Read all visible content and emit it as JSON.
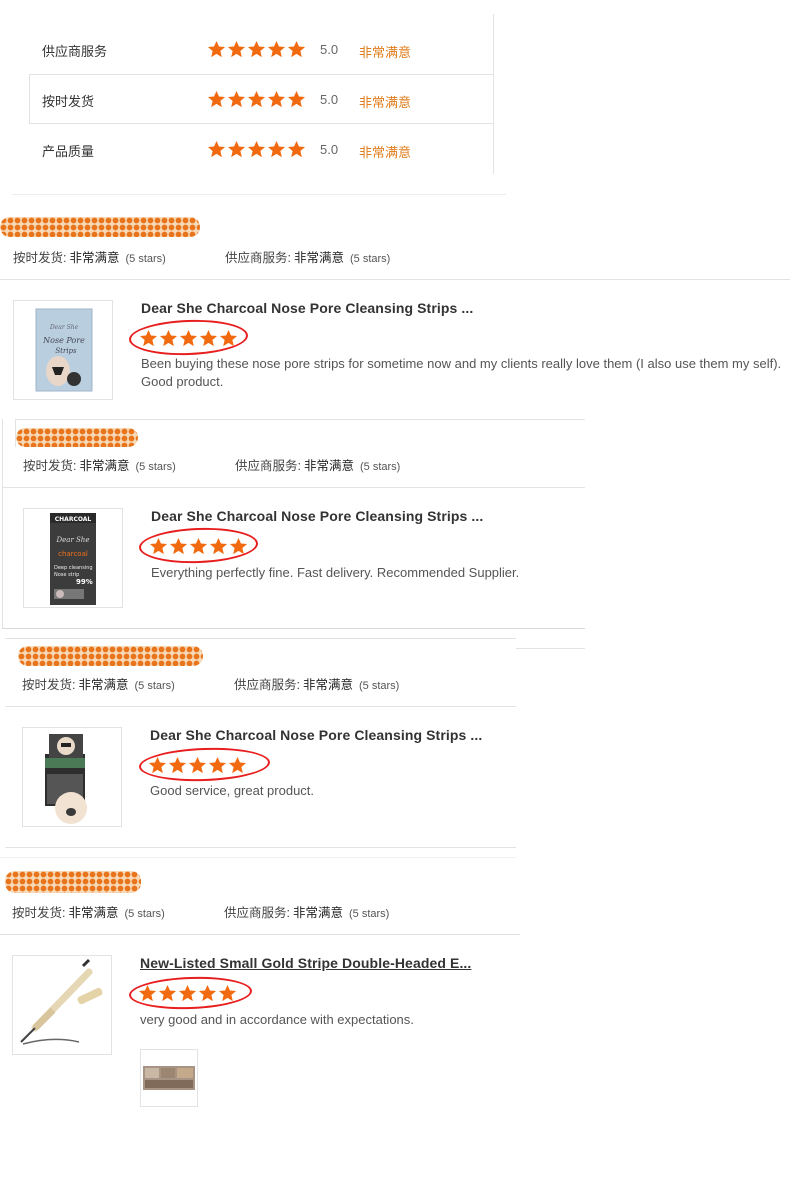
{
  "rating_rows": [
    {
      "label": "供应商服务",
      "score": "5.0",
      "rating_text": "非常满意",
      "stars": 5
    },
    {
      "label": "按时发货",
      "score": "5.0",
      "rating_text": "非常满意",
      "stars": 5
    },
    {
      "label": "产品质量",
      "score": "5.0",
      "rating_text": "非常满意",
      "stars": 5
    }
  ],
  "reviews": [
    {
      "shipping_label": "按时发货:",
      "shipping_value": "非常满意",
      "shipping_stars": "(5 stars)",
      "service_label": "供应商服务:",
      "service_value": "非常满意",
      "service_stars": "(5 stars)",
      "product_title": "Dear She Charcoal Nose Pore Cleansing Strips ...",
      "stars": 5,
      "comment": "Been buying these nose pore strips for sometime now and my clients really love them (I also use them my self). Good product.",
      "thumb_text": [
        "Dear She",
        "Nose Pore",
        "Strips"
      ]
    },
    {
      "shipping_label": "按时发货:",
      "shipping_value": "非常满意",
      "shipping_stars": "(5 stars)",
      "service_label": "供应商服务:",
      "service_value": "非常满意",
      "service_stars": "(5 stars)",
      "product_title": "Dear She Charcoal Nose Pore Cleansing Strips ...",
      "stars": 5,
      "comment": "Everything perfectly fine. Fast delivery. Recommended Supplier.",
      "thumb_text": [
        "CHARCOAL",
        "Dear She",
        "charcoal",
        "Deep cleansing",
        "Nose strip",
        "99%"
      ]
    },
    {
      "shipping_label": "按时发货:",
      "shipping_value": "非常满意",
      "shipping_stars": "(5 stars)",
      "service_label": "供应商服务:",
      "service_value": "非常满意",
      "service_stars": "(5 stars)",
      "product_title": "Dear She Charcoal Nose Pore Cleansing Strips ...",
      "stars": 5,
      "comment": "Good service, great product."
    },
    {
      "shipping_label": "按时发货:",
      "shipping_value": "非常满意",
      "shipping_stars": "(5 stars)",
      "service_label": "供应商服务:",
      "service_value": "非常满意",
      "service_stars": "(5 stars)",
      "product_title": "New-Listed Small Gold Stripe Double-Headed E...",
      "stars": 5,
      "comment": "very good and in accordance with expectations."
    }
  ],
  "colors": {
    "star": "#f26a0f",
    "accent": "#e07c1a",
    "annotation_red": "#e81e1e",
    "border": "#e3e3e3"
  }
}
